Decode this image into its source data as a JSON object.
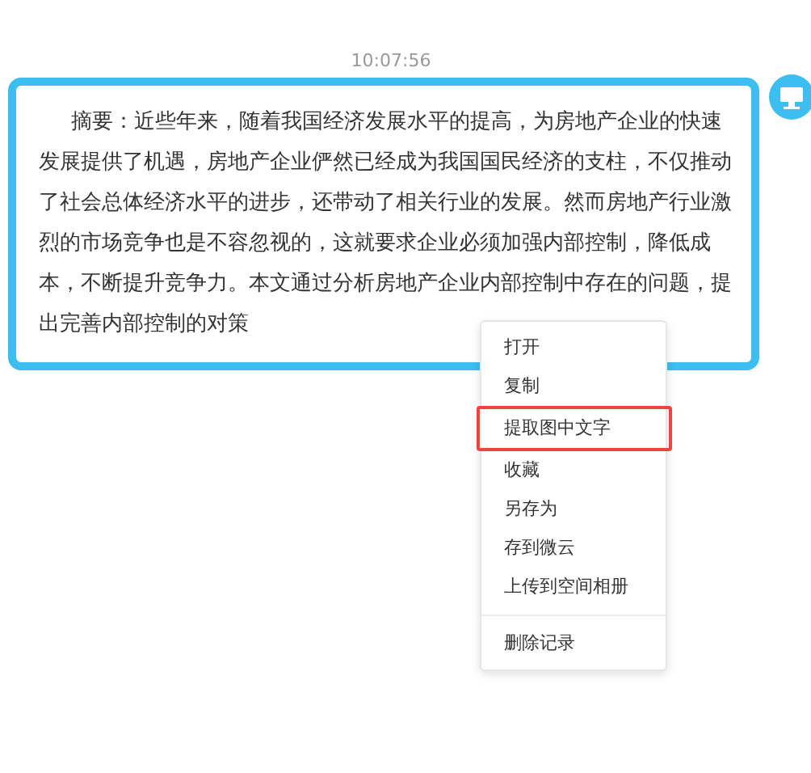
{
  "timestamp": "10:07:56",
  "message": {
    "text": "摘要：近些年来，随着我国经济发展水平的提高，为房地产企业的快速发展提供了机遇，房地产企业俨然已经成为我国国民经济的支柱，不仅推动了社会总体经济水平的进步，还带动了相关行业的发展。然而房地产行业激烈的市场竞争也是不容忽视的，这就要求企业必须加强内部控制，降低成本，不断提升竞争力。本文通过分析房地产企业内部控制中存在的问题，提出完善内部控制的对策"
  },
  "context_menu": {
    "sections": [
      {
        "items": [
          {
            "label": "打开",
            "highlighted": false
          },
          {
            "label": "复制",
            "highlighted": false
          },
          {
            "label": "提取图中文字",
            "highlighted": true
          },
          {
            "label": "收藏",
            "highlighted": false
          },
          {
            "label": "另存为",
            "highlighted": false
          },
          {
            "label": "存到微云",
            "highlighted": false
          },
          {
            "label": "上传到空间相册",
            "highlighted": false
          }
        ]
      },
      {
        "items": [
          {
            "label": "删除记录",
            "highlighted": false
          }
        ]
      }
    ]
  }
}
